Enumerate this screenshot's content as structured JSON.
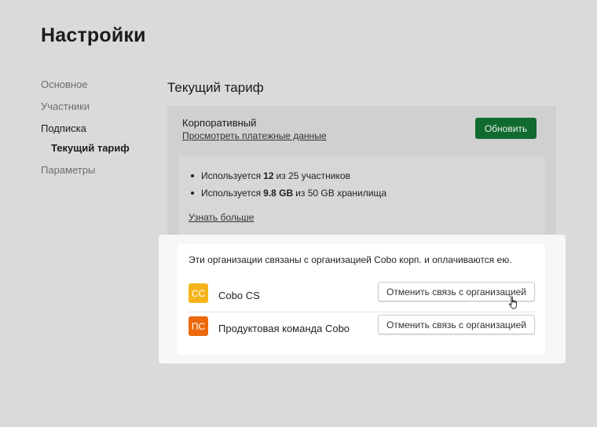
{
  "page": {
    "title": "Настройки"
  },
  "nav": {
    "items": [
      {
        "label": "Основное"
      },
      {
        "label": "Участники"
      },
      {
        "label": "Подписка"
      },
      {
        "label": "Текущий тариф"
      },
      {
        "label": "Параметры"
      }
    ]
  },
  "plan": {
    "section_title": "Текущий тариф",
    "name": "Корпоративный",
    "billing_link": "Просмотреть платежные данные",
    "upgrade_label": "Обновить",
    "upgrade_color": "#116a2f",
    "usage": [
      {
        "prefix": "Используется",
        "value": "12",
        "suffix": "из 25 участников"
      },
      {
        "prefix": "Используется",
        "value": "9.8 GB",
        "suffix": "из 50 GB хранилища"
      }
    ],
    "learn_more": "Узнать больше"
  },
  "linked_orgs": {
    "intro": "Эти организации связаны с организацией Cobo корп. и оплачиваются ею.",
    "items": [
      {
        "badge": "CC",
        "badge_color": "#f5b41a",
        "name": "Cobo CS",
        "unlink_label": "Отменить связь с организацией"
      },
      {
        "badge": "ПС",
        "badge_color": "#ec6a0d",
        "name": "Продуктовая команда Cobo",
        "unlink_label": "Отменить связь с организацией"
      }
    ]
  },
  "icons": {
    "cursor": "hand-pointer-icon"
  }
}
